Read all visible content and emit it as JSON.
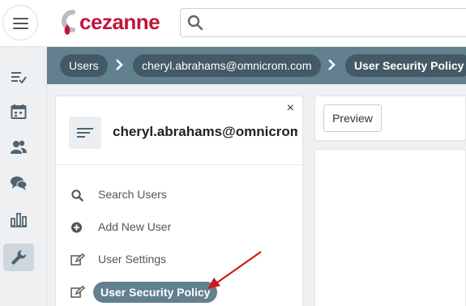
{
  "app": {
    "logo_text": "cezanne",
    "brand_color": "#c4143c"
  },
  "search": {
    "placeholder": "",
    "value": ""
  },
  "rail": {
    "items": [
      {
        "name": "tasks",
        "icon": "checklist-icon"
      },
      {
        "name": "calendar",
        "icon": "calendar-icon"
      },
      {
        "name": "people",
        "icon": "people-icon"
      },
      {
        "name": "messages",
        "icon": "chat-icon"
      },
      {
        "name": "reports",
        "icon": "bar-chart-icon"
      },
      {
        "name": "admin",
        "icon": "wrench-icon",
        "active": true
      }
    ]
  },
  "breadcrumb": {
    "items": [
      "Users",
      "cheryl.abrahams@omnicrom.com",
      "User Security Policy"
    ]
  },
  "panel": {
    "title": "cheryl.abrahams@omnicrom.com",
    "close_label": "×",
    "menu": [
      {
        "label": "Search Users",
        "icon": "search-icon"
      },
      {
        "label": "Add New User",
        "icon": "plus-circle-icon"
      },
      {
        "label": "User Settings",
        "icon": "edit-icon"
      },
      {
        "label": "User Security Policy",
        "icon": "edit-icon",
        "active": true
      }
    ]
  },
  "toolbar": {
    "preview_label": "Preview"
  },
  "colors": {
    "breadcrumb_bar": "#63808f",
    "breadcrumb_pill": "#435a66",
    "active_pill": "#63808f",
    "annotation_arrow": "#cc1a1a"
  }
}
